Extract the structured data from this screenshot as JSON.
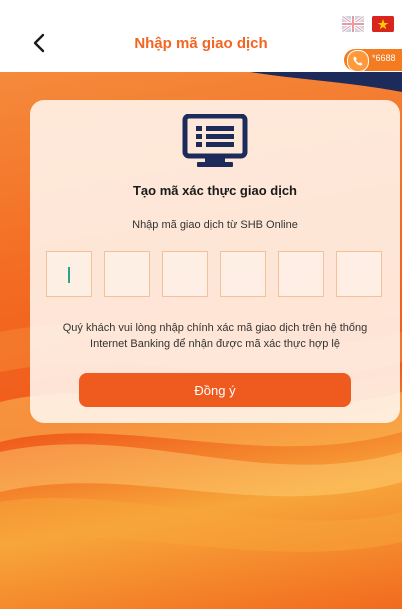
{
  "header": {
    "title": "Nhập mã giao dịch",
    "back_icon": "chevron-left-icon",
    "languages": [
      "English",
      "Tiếng Việt"
    ],
    "hotline": "*6688"
  },
  "card": {
    "icon": "monitor-list-icon",
    "title": "Tạo mã xác thực giao dịch",
    "subtitle": "Nhập mã giao dịch từ SHB Online",
    "code_values": [
      "",
      "",
      "",
      "",
      "",
      ""
    ],
    "note": "Quý khách vui lòng nhập chính xác mã giao dịch trên hệ thống Internet Banking để nhận được mã xác thực hợp lệ",
    "agree_label": "Đồng ý"
  },
  "colors": {
    "accent": "#f26522",
    "icon_navy": "#1c2b5a",
    "button": "#ef5a1e"
  }
}
